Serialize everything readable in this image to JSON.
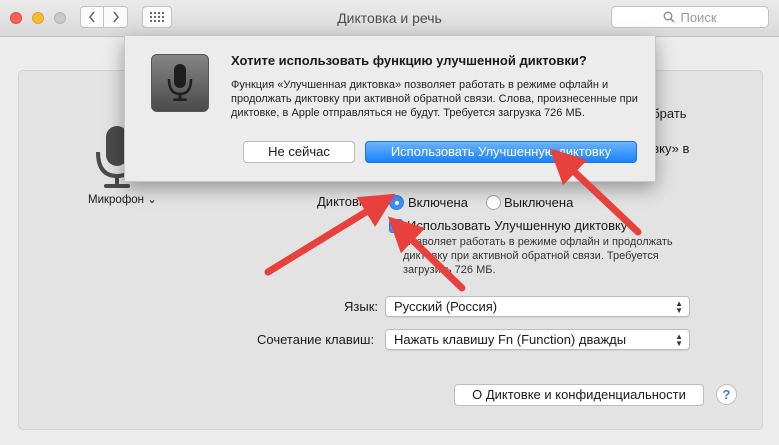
{
  "window": {
    "title": "Диктовка и речь",
    "search_placeholder": "Поиск"
  },
  "panel": {
    "mic_label": "Микрофон",
    "behind_text_1": "абрать",
    "behind_text_2": "овку» в",
    "dictation_label": "Диктовка:",
    "radio_on_label": "Включена",
    "radio_off_label": "Выключена",
    "enhanced_checkbox_label": "Использовать Улучшенную диктовку",
    "enhanced_checked": true,
    "enhanced_desc": "Позволяет работать в режиме офлайн и продолжать диктовку при активной обратной связи. Требуется загрузить 726 МБ.",
    "language_label": "Язык:",
    "language_value": "Русский (Россия)",
    "shortcut_label": "Сочетание клавиш:",
    "shortcut_value": "Нажать клавишу Fn (Function) дважды",
    "privacy_button": "О Диктовке и конфиденциальности",
    "help_glyph": "?"
  },
  "sheet": {
    "title": "Хотите использовать функцию улучшенной диктовки?",
    "body": "Функция «Улучшенная диктовка» позволяет работать в режиме офлайн и продолжать диктовку при активной обратной связи. Слова, произнесенные при диктовке, в Apple отправляться не будут. Требуется загрузка 726 МБ.",
    "cancel_button": "Не сейчас",
    "confirm_button": "Использовать Улучшенную диктовку"
  },
  "colors": {
    "accent": "#1a82fb",
    "arrow": "#e8403d"
  },
  "icons": [
    "close-light",
    "minimize-light",
    "zoom-light",
    "chevron-left-icon",
    "chevron-right-icon",
    "grid-icon",
    "search-icon",
    "microphone-icon",
    "checkmark-icon",
    "help-icon"
  ]
}
